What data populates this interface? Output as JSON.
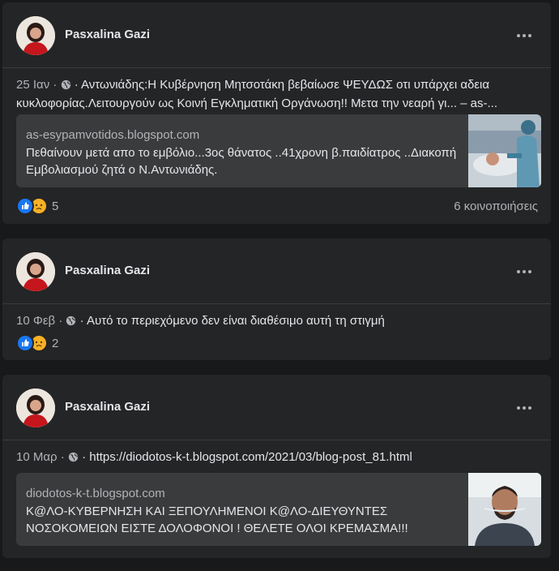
{
  "posts": [
    {
      "author": "Pasxalina Gazi",
      "date": "25 Ιαν",
      "separator": "·",
      "text": "· Αντωνιάδης:Η Κυβέρνηση Μητσοτάκη βεβαίωσε ΨΕΥΔΩΣ οτι υπάρχει αδεια κυκλοφορίας.Λειτουργούν ως Κοινή Εγκληματική Οργάνωση!! Μετα την νεαρή γι... – as-...",
      "preview_domain": "as-esypamvotidos.blogspot.com",
      "preview_text": "Πεθαίνουν μετά απο το εμβόλιο...3ος θάνατος ..41χρονη β.παιδίατρος ..Διακοπή Εμβολιασμού ζητά ο Ν.Αντωνιάδης.",
      "reactions_count": "5",
      "shares": "6 κοινοποιήσεις",
      "thumb_icon": "hospital-photo-icon"
    },
    {
      "author": "Pasxalina Gazi",
      "date": "10 Φεβ",
      "separator": "·",
      "text": "· Αυτό το περιεχόμενο δεν είναι διαθέσιμο αυτή τη στιγμή",
      "reactions_count": "2"
    },
    {
      "author": "Pasxalina Gazi",
      "date": "10 Μαρ",
      "separator": "·",
      "text": "· https://diodotos-k-t.blogspot.com/2021/03/blog-post_81.html",
      "preview_domain": "diodotos-k-t.blogspot.com",
      "preview_text": "Κ@ΛΟ-ΚΥΒΕΡΝΗΣΗ ΚΑΙ ΞΕΠΟΥΛΗΜΕΝΟΙ Κ@ΛΟ-ΔΙΕΥΘΥΝΤΕΣ ΝΟΣΟΚΟΜΕΙΩΝ ΕΙΣΤΕ ΔΟΛΟΦΟΝΟΙ ! ΘΕΛΕΤΕ ΟΛΟΙ ΚΡΕΜΑΣΜΑ!!!",
      "thumb_icon": "patient-photo-icon"
    }
  ],
  "colors": {
    "page_bg": "#18191a",
    "card_bg": "#242526",
    "preview_bg": "#3a3b3c",
    "text": "#e4e6eb",
    "secondary": "#b0b3b8",
    "like_blue": "#1877f2",
    "sad_yellow": "#f7b125"
  },
  "icons": [
    "avatar",
    "more-options-icon",
    "globe-icon",
    "like-reaction-icon",
    "sad-reaction-icon"
  ]
}
